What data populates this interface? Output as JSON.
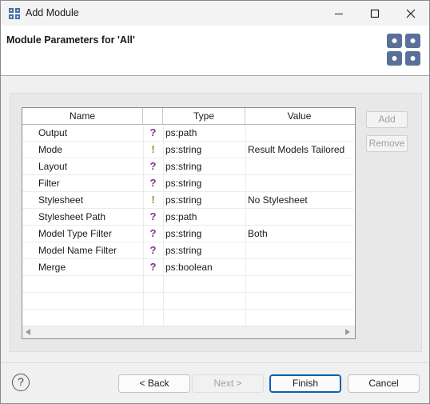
{
  "window": {
    "title": "Add Module"
  },
  "header": {
    "title": "Module Parameters for 'All'"
  },
  "table": {
    "columns": [
      "Name",
      "",
      "Type",
      "Value"
    ],
    "rows": [
      {
        "name": "Output",
        "icon": "?",
        "type": "ps:path",
        "value": ""
      },
      {
        "name": "Mode",
        "icon": "!",
        "type": "ps:string",
        "value": "Result Models Tailored"
      },
      {
        "name": "Layout",
        "icon": "?",
        "type": "ps:string",
        "value": ""
      },
      {
        "name": "Filter",
        "icon": "?",
        "type": "ps:string",
        "value": ""
      },
      {
        "name": "Stylesheet",
        "icon": "!",
        "type": "ps:string",
        "value": "No Stylesheet"
      },
      {
        "name": "Stylesheet Path",
        "icon": "?",
        "type": "ps:path",
        "value": ""
      },
      {
        "name": "Model Type Filter",
        "icon": "?",
        "type": "ps:string",
        "value": "Both"
      },
      {
        "name": "Model Name Filter",
        "icon": "?",
        "type": "ps:string",
        "value": ""
      },
      {
        "name": "Merge",
        "icon": "?",
        "type": "ps:boolean",
        "value": ""
      }
    ],
    "icon_colors": {
      "?": "#8b2f8f",
      "!": "#9a8a2a"
    }
  },
  "side_buttons": {
    "add": "Add",
    "remove": "Remove"
  },
  "footer": {
    "help": "?",
    "back": "< Back",
    "next": "Next >",
    "finish": "Finish",
    "cancel": "Cancel"
  },
  "colors": {
    "accent": "#0a5fb4",
    "header_icon": "#5a6f9a"
  }
}
